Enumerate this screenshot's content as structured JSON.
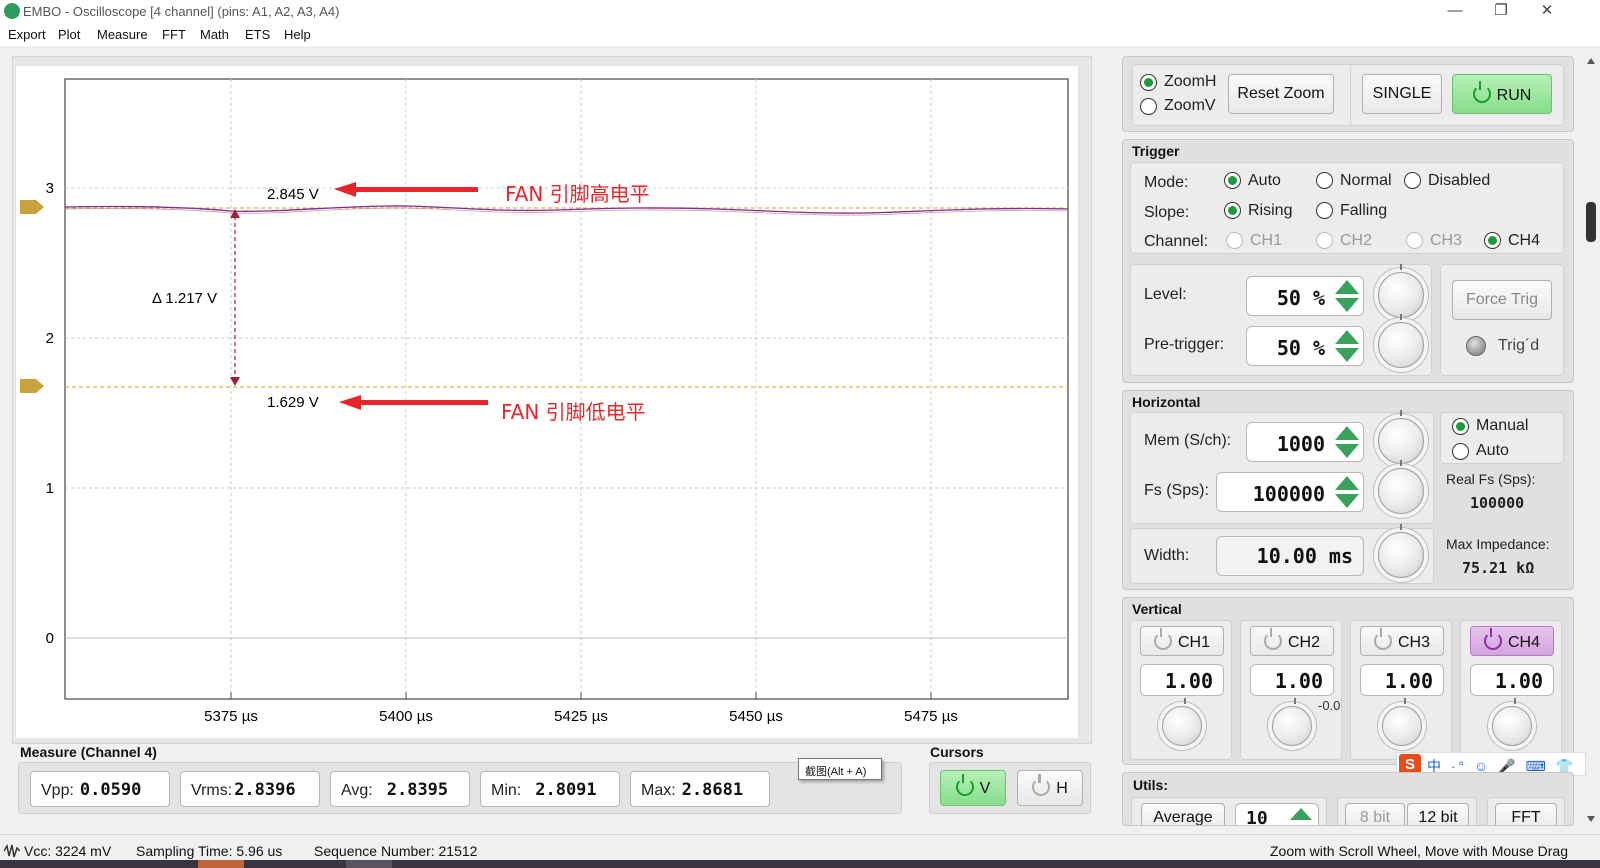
{
  "window": {
    "title": "EMBO - Oscilloscope [4 channel] (pins: A1, A2, A3, A4)",
    "minimize_glyph": "—",
    "restore_glyph": "❐",
    "close_glyph": "✕"
  },
  "menu": [
    "Export",
    "Plot",
    "Measure",
    "FFT",
    "Math",
    "ETS",
    "Help"
  ],
  "plot": {
    "y_ticks": [
      "3",
      "2",
      "1",
      "0"
    ],
    "x_ticks": [
      "5375 µs",
      "5400 µs",
      "5425 µs",
      "5450 µs",
      "5475 µs"
    ],
    "cursor_high_label": "2.845 V",
    "cursor_low_label": "1.629 V",
    "delta_label": "Δ 1.217 V",
    "annotation_high": "FAN 引脚高电平",
    "annotation_low": "FAN 引脚低电平",
    "trace_color": "#7b2f8e",
    "cursor_color": "#e0b04a",
    "annotation_color": "#e8262a"
  },
  "measure": {
    "title": "Measure (Channel 4)",
    "items": [
      {
        "label": "Vpp:",
        "value": "0.0590"
      },
      {
        "label": "Vrms:",
        "value": "2.8396"
      },
      {
        "label": "Avg:",
        "value": "2.8395"
      },
      {
        "label": "Min:",
        "value": "2.8091"
      },
      {
        "label": "Max:",
        "value": "2.8681"
      }
    ]
  },
  "tooltip": "截图(Alt + A)",
  "cursors": {
    "title": "Cursors",
    "v_label": "V",
    "h_label": "H"
  },
  "zoom": {
    "zoomh": "ZoomH",
    "zoomv": "ZoomV",
    "reset": "Reset Zoom",
    "single": "SINGLE",
    "run": "RUN"
  },
  "trigger": {
    "title": "Trigger",
    "mode_label": "Mode:",
    "modes": [
      "Auto",
      "Normal",
      "Disabled"
    ],
    "slope_label": "Slope:",
    "slopes": [
      "Rising",
      "Falling"
    ],
    "channel_label": "Channel:",
    "channels": [
      "CH1",
      "CH2",
      "CH3",
      "CH4"
    ],
    "level_label": "Level:",
    "level_value": "50",
    "pretrigger_label": "Pre-trigger:",
    "pretrigger_value": "50",
    "unit": "%",
    "force_trig": "Force Trig",
    "trigd": "Trig´d"
  },
  "horizontal": {
    "title": "Horizontal",
    "mem_label": "Mem (S/ch):",
    "mem_value": "1000",
    "fs_label": "Fs (Sps):",
    "fs_value": "100000",
    "width_label": "Width:",
    "width_value": "10.00 ms",
    "manual": "Manual",
    "auto": "Auto",
    "real_fs_label": "Real Fs (Sps):",
    "real_fs_value": "100000",
    "max_imp_label": "Max Impedance:",
    "max_imp_value": "75.21 kΩ"
  },
  "vertical": {
    "title": "Vertical",
    "channels": [
      {
        "name": "CH1",
        "value": "1.00"
      },
      {
        "name": "CH2",
        "value": "1.00"
      },
      {
        "name": "CH3",
        "value": "1.00"
      },
      {
        "name": "CH4",
        "value": "1.00"
      }
    ],
    "ch2_offset": "-0.0"
  },
  "utils": {
    "title": "Utils:",
    "average": "Average",
    "avg_value": "10",
    "bit8": "8 bit",
    "bit12": "12 bit",
    "fft": "FFT"
  },
  "status": {
    "vcc": "Vcc: 3224 mV",
    "sampling": "Sampling Time: 5.96 us",
    "sequence": "Sequence Number: 21512",
    "hint": "Zoom with Scroll Wheel, Move with Mouse Drag"
  },
  "ime": "中 ·° ☺ 🎤 ⌨ 👕 ▦"
}
